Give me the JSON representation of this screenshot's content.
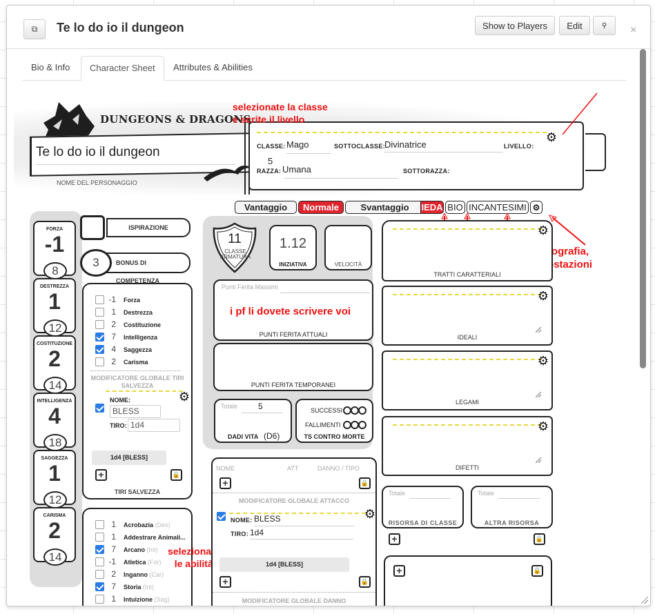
{
  "window": {
    "title": "Te lo do io il dungeon",
    "buttons": {
      "show_to_players": "Show to Players",
      "edit": "Edit",
      "search_icon": "🔍",
      "popout_icon": "⧉",
      "close": "×"
    }
  },
  "tabs": [
    {
      "label": "Bio & Info",
      "active": false
    },
    {
      "label": "Character Sheet",
      "active": true
    },
    {
      "label": "Attributes & Abilities",
      "active": false
    }
  ],
  "header": {
    "logo": "DUNGEONS & DRAGONS",
    "character_name": "Te lo do io il dungeon",
    "character_name_label": "NOME DEL PERSONAGGIO",
    "classe_label": "CLASSE:",
    "classe": "Mago",
    "sottoclasse_label": "SOTTOCLASSE:",
    "sottoclasse": "Divinatrice",
    "livello_label": "LIVELLO:",
    "livello": "5",
    "razza_label": "RAZZA:",
    "razza": "Umana",
    "sottorazza_label": "SOTTORAZZA:",
    "sottorazza": ""
  },
  "roll_modes": {
    "vantaggio": "Vantaggio",
    "normale": "Normale",
    "svantaggio": "Svantaggio",
    "selected": "Normale"
  },
  "nav": {
    "scheda": "IEDA",
    "bio": "BIO",
    "incantesimi": "INCANTESIMI"
  },
  "annotations": {
    "class_hint_1": "selezionate la classe",
    "class_hint_2": "e scrite il livello",
    "nav_hint_1": "accesso alla scheda, biografia,",
    "nav_hint_2": "lista incantesimi e impostazioni",
    "hp_hint": "i pf li dovete scrivere voi",
    "skills_hint_1": "selezionate",
    "skills_hint_2": "le abilità"
  },
  "abilities": [
    {
      "name": "FORZA",
      "mod": "-1",
      "score": "8"
    },
    {
      "name": "DESTREZZA",
      "mod": "1",
      "score": "12"
    },
    {
      "name": "COSTITUZIONE",
      "mod": "2",
      "score": "14"
    },
    {
      "name": "INTELLIGENZA",
      "mod": "4",
      "score": "18"
    },
    {
      "name": "SAGGEZZA",
      "mod": "1",
      "score": "12"
    },
    {
      "name": "CARISMA",
      "mod": "2",
      "score": "14"
    }
  ],
  "inspiration_label": "ISPIRAZIONE",
  "proficiency": {
    "value": "3",
    "label": "BONUS DI COMPETENZA"
  },
  "saving_throws": {
    "items": [
      {
        "value": "-1",
        "label": "Forza",
        "checked": false
      },
      {
        "value": "1",
        "label": "Destrezza",
        "checked": false
      },
      {
        "value": "2",
        "label": "Costituzione",
        "checked": false
      },
      {
        "value": "7",
        "label": "Intelligenza",
        "checked": true
      },
      {
        "value": "4",
        "label": "Saggezza",
        "checked": true
      },
      {
        "value": "2",
        "label": "Carisma",
        "checked": false
      }
    ],
    "global_mod_title": "MODIFICATORE GLOBALE TIRI SALVEZZA",
    "nome_label": "NOME:",
    "nome": "BLESS",
    "tiro_label": "TIRO:",
    "tiro": "1d4",
    "result": "1d4 [BLESS]",
    "footer": "TIRI SALVEZZA"
  },
  "skills": [
    {
      "value": "1",
      "label": "Acrobazia",
      "attr": "(Des)",
      "checked": false
    },
    {
      "value": "1",
      "label": "Addestrare Animali...",
      "attr": "",
      "checked": false
    },
    {
      "value": "7",
      "label": "Arcano",
      "attr": "(Int)",
      "checked": true
    },
    {
      "value": "-1",
      "label": "Atletica",
      "attr": "(For)",
      "checked": false
    },
    {
      "value": "2",
      "label": "Inganno",
      "attr": "(Car)",
      "checked": false
    },
    {
      "value": "7",
      "label": "Storia",
      "attr": "(Int)",
      "checked": true
    },
    {
      "value": "1",
      "label": "Intuizione",
      "attr": "(Sag)",
      "checked": false
    }
  ],
  "combat": {
    "ac": "11",
    "ac_label": "CLASSE ARMATURA",
    "initiative": "1.12",
    "initiative_label": "INIZIATIVA",
    "speed": "",
    "speed_label": "VELOCITÀ",
    "hp_max_placeholder": "Punti Ferita Massimi",
    "hp_current_label": "PUNTI FERITA ATTUALI",
    "hp_temp_label": "PUNTI FERITA TEMPORANEI",
    "hit_dice_total_label": "Totale",
    "hit_dice_total": "5",
    "hit_dice_label": "DADI VITA",
    "hit_dice_type": "(D6)",
    "death_success": "SUCCESSI",
    "death_fail": "FALLIMENTI",
    "death_label": "TS CONTRO MORTE"
  },
  "attacks": {
    "col_name": "NOME",
    "col_att": "ATT",
    "col_damage": "DANNO / TIPO",
    "global_title": "MODIFICATORE GLOBALE ATTACCO",
    "nome_label": "NOME:",
    "nome": "BLESS",
    "tiro_label": "TIRO:",
    "tiro": "1d4",
    "result": "1d4 [BLESS]",
    "global_damage_title": "MODIFICATORE GLOBALE DANNO"
  },
  "traits": [
    {
      "label": "TRATTI CARATTERIALI"
    },
    {
      "label": "IDEALI"
    },
    {
      "label": "LEGAMI"
    },
    {
      "label": "DIFETTI"
    }
  ],
  "resources": {
    "total_label": "Totale",
    "class_resource": "RISORSA DI CLASSE",
    "other_resource": "ALTRA RISORSA"
  }
}
